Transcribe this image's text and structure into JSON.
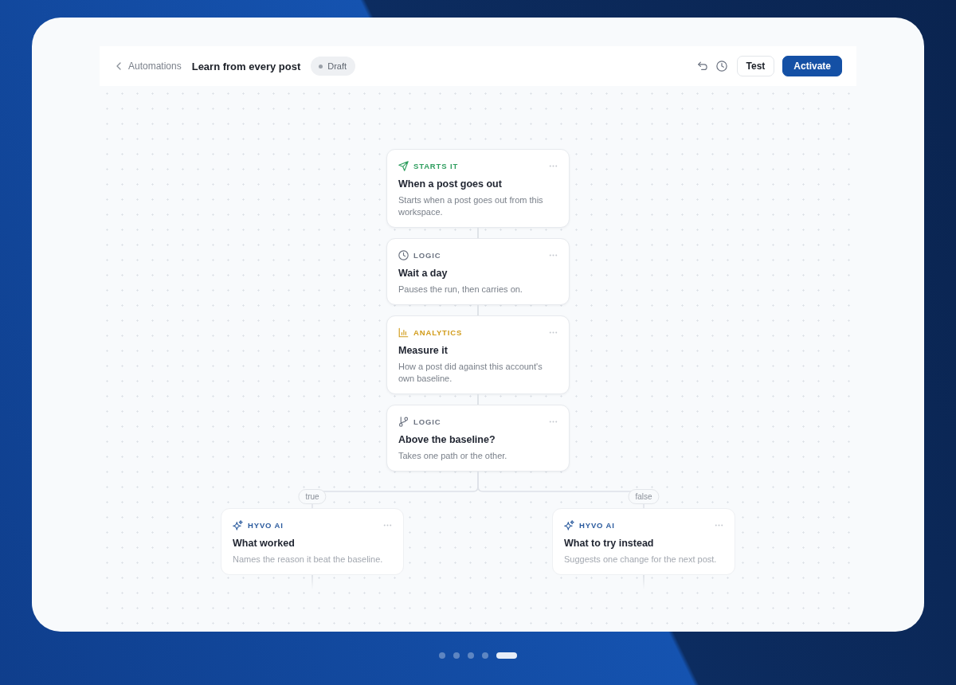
{
  "header": {
    "back_link": "Automations",
    "title": "Learn from every post",
    "status": "Draft",
    "buttons": [
      {
        "label": "Test",
        "kind": "secondary"
      },
      {
        "label": "Activate",
        "kind": "primary"
      }
    ]
  },
  "flow": {
    "steps": [
      {
        "kind": "trigger",
        "category": "STARTS IT",
        "title": "When a post goes out",
        "description": "Starts when a post goes out from this workspace."
      },
      {
        "kind": "wait",
        "category": "LOGIC",
        "title": "Wait a day",
        "description": "Pauses the run, then carries on."
      },
      {
        "kind": "analytics",
        "category": "ANALYTICS",
        "title": "Measure it",
        "description": "How a post did against this account's own baseline."
      },
      {
        "kind": "condition",
        "category": "LOGIC",
        "title": "Above the baseline?",
        "description": "Takes one path or the other."
      }
    ],
    "branches": [
      {
        "label": "true",
        "step": {
          "kind": "ai",
          "category": "HYVO AI",
          "title": "What worked",
          "description": "Names the reason it beat the baseline."
        }
      },
      {
        "label": "false",
        "step": {
          "kind": "ai",
          "category": "HYVO AI",
          "title": "What to try instead",
          "description": "Suggests one change for the next post."
        }
      }
    ]
  },
  "pager": {
    "pages": [
      {
        "selected": false
      },
      {
        "selected": false
      },
      {
        "selected": false
      },
      {
        "selected": false
      },
      {
        "selected": true
      }
    ]
  }
}
